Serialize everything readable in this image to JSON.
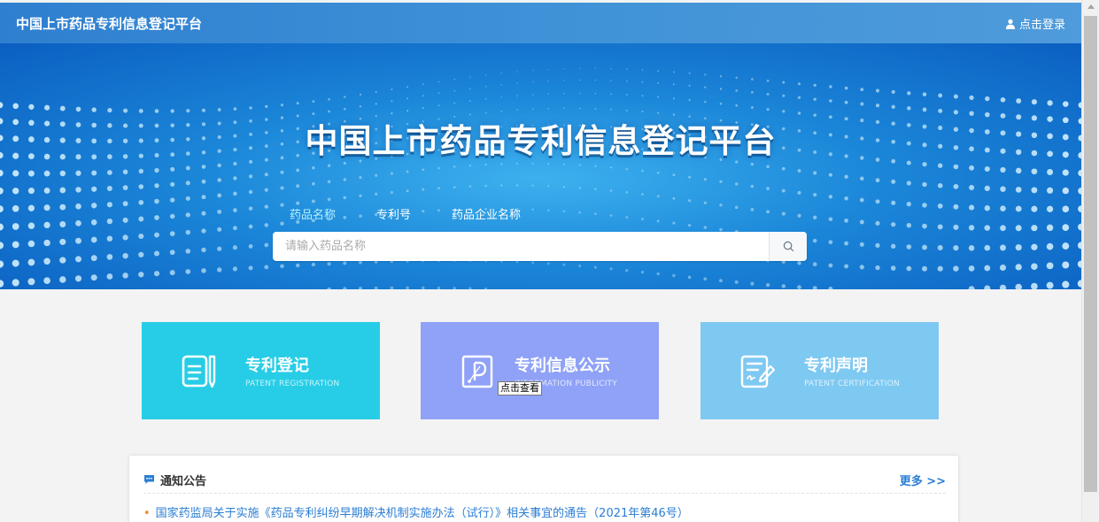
{
  "header": {
    "brand": "中国上市药品专利信息登记平台",
    "login_label": "点击登录"
  },
  "hero": {
    "title": "中国上市药品专利信息登记平台",
    "tabs": [
      {
        "label": "药品名称",
        "active": true
      },
      {
        "label": "专利号",
        "active": false
      },
      {
        "label": "药品企业名称",
        "active": false
      }
    ],
    "search_placeholder": "请输入药品名称"
  },
  "cards": [
    {
      "title": "专利登记",
      "subtitle": "PATENT REGISTRATION",
      "color": "#27cde6",
      "icon": "document-edit-icon"
    },
    {
      "title": "专利信息公示",
      "subtitle": "INFORMATION PUBLICITY",
      "color": "#8fa2f7",
      "icon": "patent-info-icon"
    },
    {
      "title": "专利声明",
      "subtitle": "PATENT CERTIFICATION",
      "color": "#7ec9f2",
      "icon": "certificate-sign-icon"
    }
  ],
  "tooltip": "点击查看",
  "notice": {
    "title": "通知公告",
    "more_label": "更多 >>",
    "items": [
      "国家药监局关于实施《药品专利纠纷早期解决机制实施办法（试行）》相关事宜的通告（2021年第46号）"
    ]
  },
  "colors": {
    "accent": "#2a7ed3",
    "header": "#3f92d7",
    "bullet": "#f08a2c"
  }
}
